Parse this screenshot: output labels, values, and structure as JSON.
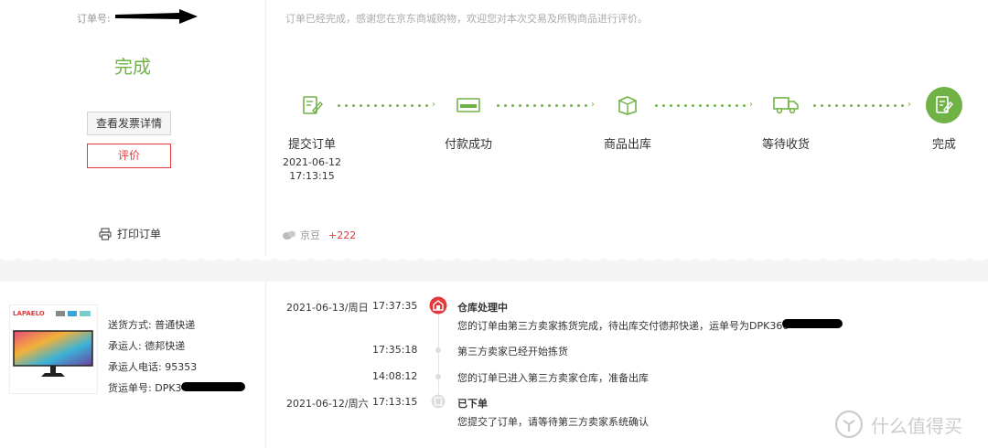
{
  "order": {
    "label": "订单号:"
  },
  "status": {
    "text": "完成"
  },
  "buttons": {
    "invoice": "查看发票详情",
    "review": "评价",
    "print": "打印订单"
  },
  "notice": "订单已经完成，感谢您在京东商城购物，欢迎您对本次交易及所购商品进行评价。",
  "steps": [
    {
      "label": "提交订单",
      "date": "2021-06-12",
      "time": "17:13:15",
      "icon": "edit-doc-icon"
    },
    {
      "label": "付款成功",
      "icon": "card-icon"
    },
    {
      "label": "商品出库",
      "icon": "box-icon"
    },
    {
      "label": "等待收货",
      "icon": "truck-icon"
    },
    {
      "label": "完成",
      "icon": "done-icon"
    }
  ],
  "beans": {
    "name": "京豆",
    "value": "+222"
  },
  "shipping": {
    "method_label": "送货方式:",
    "method": "普通快递",
    "carrier_label": "承运人:",
    "carrier": "德邦快递",
    "phone_label": "承运人电话:",
    "phone": "95353",
    "tracking_label": "货运单号:",
    "tracking": "DPK3"
  },
  "timeline": [
    {
      "date": "2021-06-13/周日",
      "time": "17:37:35",
      "title": "仓库处理中",
      "text": "您的订单由第三方卖家拣货完成，待出库交付德邦快递，运单号为DPK366"
    },
    {
      "time": "17:35:18",
      "text": "第三方卖家已经开始拣货"
    },
    {
      "time": "14:08:12",
      "text": "您的订单已进入第三方卖家仓库，准备出库"
    },
    {
      "date": "2021-06-12/周六",
      "time": "17:13:15",
      "title": "已下单",
      "text": "您提交了订单，请等待第三方卖家系统确认"
    }
  ],
  "product_image": {
    "brand": "LAPAELO"
  },
  "watermark": "什么值得买",
  "colors": {
    "green": "#71b247",
    "red": "#e4393c"
  }
}
